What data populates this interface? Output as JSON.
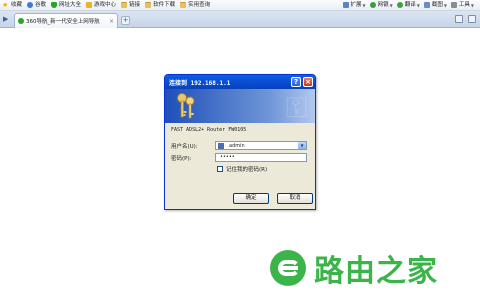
{
  "favorites": {
    "left": [
      {
        "label": "收藏",
        "icon": "star-icon"
      },
      {
        "label": "谷歌",
        "icon": "google-icon"
      },
      {
        "label": "网址大全",
        "icon": "shield-icon"
      },
      {
        "label": "游戏中心",
        "icon": "game-icon"
      },
      {
        "label": "链接",
        "icon": "folder-icon"
      },
      {
        "label": "软件下载",
        "icon": "folder-icon"
      },
      {
        "label": "实用查询",
        "icon": "folder-icon"
      }
    ],
    "right": [
      {
        "label": "扩展",
        "icon": "extensions-icon"
      },
      {
        "label": "网银",
        "icon": "bank-icon"
      },
      {
        "label": "翻译",
        "icon": "translate-icon"
      },
      {
        "label": "截图",
        "icon": "screenshot-icon"
      },
      {
        "label": "工具",
        "icon": "tools-icon"
      }
    ]
  },
  "tab": {
    "title": "360导航_新一代安全上网导航"
  },
  "dialog": {
    "title": "连接到 192.168.1.1",
    "realm": "FAST ADSL2+ Router FW0105",
    "username_label": "用户名(U):",
    "username_value": "admin",
    "password_label": "密码(P):",
    "password_value": "•••••",
    "remember_label": "记住我的密码(R)",
    "ok_label": "确定",
    "cancel_label": "取消"
  },
  "watermark": {
    "text": "路由之家"
  },
  "colors": {
    "titlebar": "#0a4ad0",
    "brand_green": "#3bb54a"
  }
}
